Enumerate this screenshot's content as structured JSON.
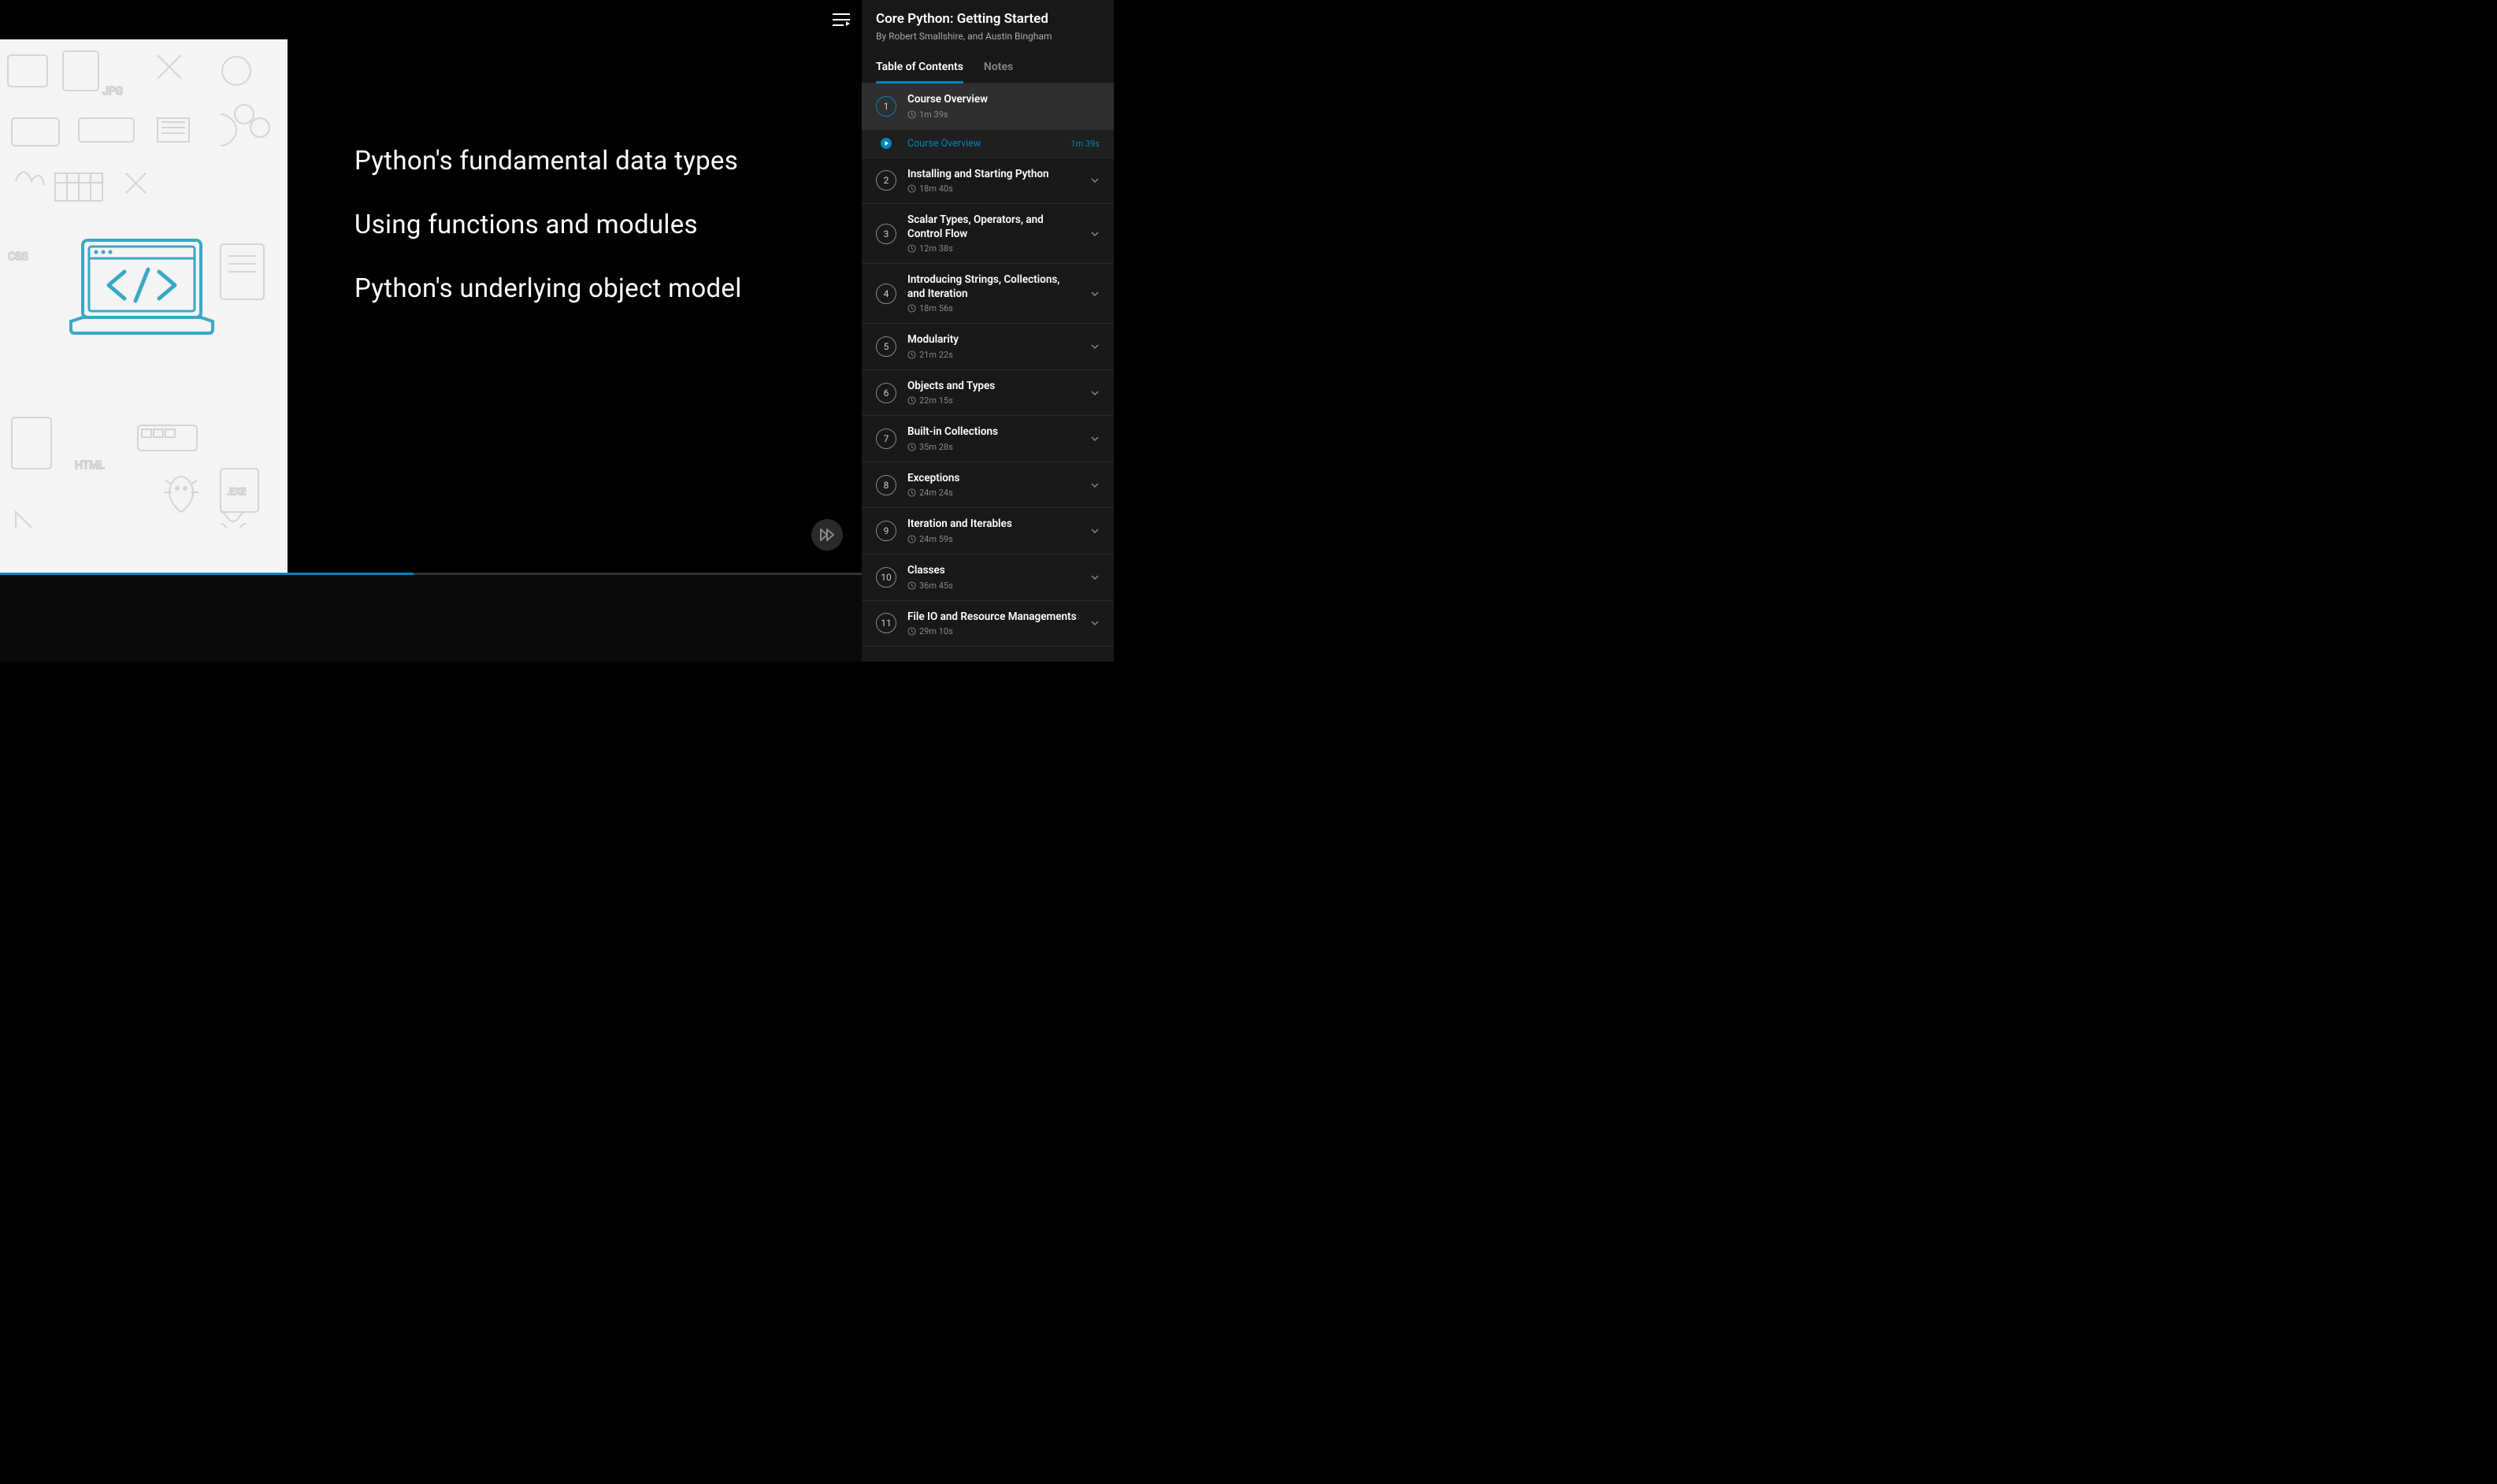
{
  "course": {
    "title": "Core Python: Getting Started",
    "byline": "By Robert Smallshire, and Austin Bingham"
  },
  "tabs": {
    "toc": "Table of Contents",
    "notes": "Notes"
  },
  "slide": {
    "lines": [
      "Python's fundamental data types",
      "Using functions and modules",
      "Python's underlying object model"
    ]
  },
  "activeClip": {
    "title": "Course Overview",
    "duration": "1m 39s"
  },
  "modules": [
    {
      "num": "1",
      "title": "Course Overview",
      "duration": "1m 39s",
      "expanded": true
    },
    {
      "num": "2",
      "title": "Installing and Starting Python",
      "duration": "18m 40s",
      "expanded": false
    },
    {
      "num": "3",
      "title": "Scalar Types, Operators, and Control Flow",
      "duration": "12m 38s",
      "expanded": false
    },
    {
      "num": "4",
      "title": "Introducing Strings, Collections, and Iteration",
      "duration": "18m 56s",
      "expanded": false
    },
    {
      "num": "5",
      "title": "Modularity",
      "duration": "21m 22s",
      "expanded": false
    },
    {
      "num": "6",
      "title": "Objects and Types",
      "duration": "22m 15s",
      "expanded": false
    },
    {
      "num": "7",
      "title": "Built-in Collections",
      "duration": "35m 28s",
      "expanded": false
    },
    {
      "num": "8",
      "title": "Exceptions",
      "duration": "24m 24s",
      "expanded": false
    },
    {
      "num": "9",
      "title": "Iteration and Iterables",
      "duration": "24m 59s",
      "expanded": false
    },
    {
      "num": "10",
      "title": "Classes",
      "duration": "36m 45s",
      "expanded": false
    },
    {
      "num": "11",
      "title": "File IO and Resource Managements",
      "duration": "29m 10s",
      "expanded": false
    }
  ]
}
